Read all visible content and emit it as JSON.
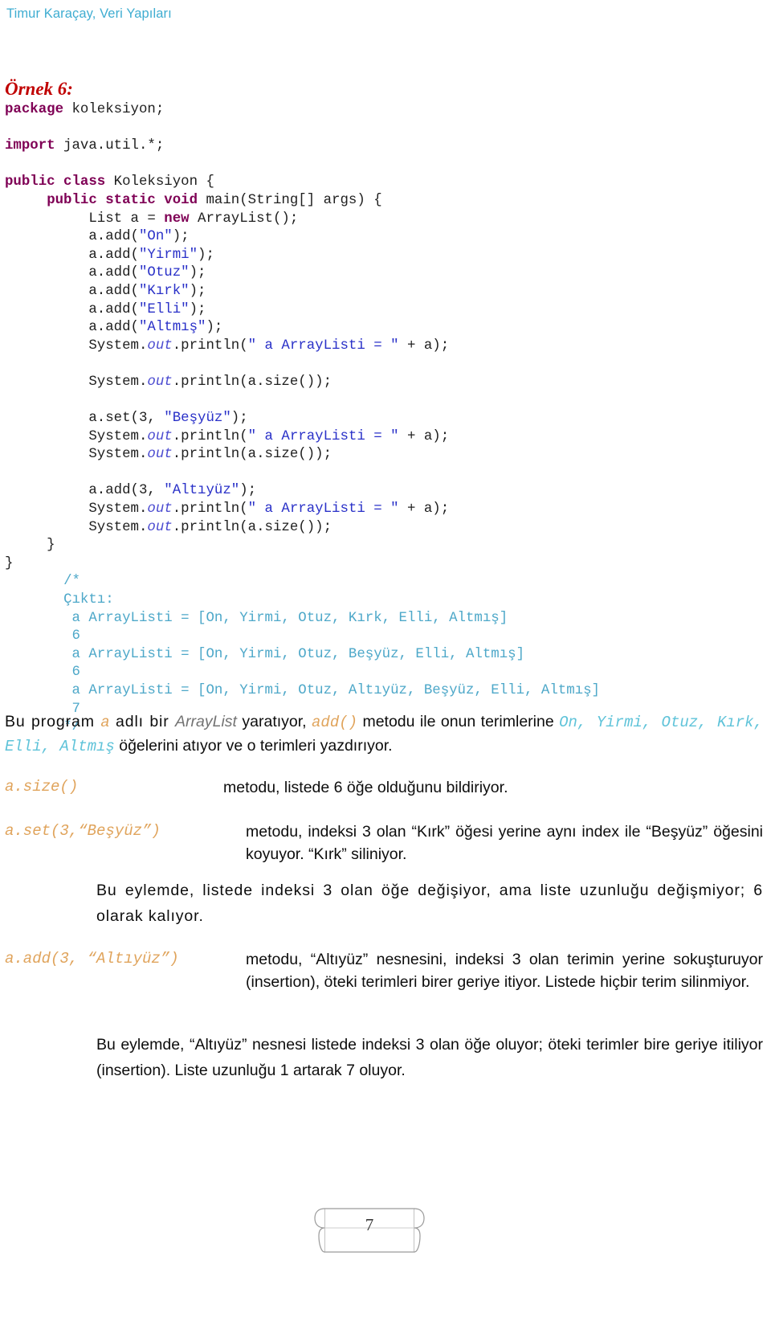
{
  "header": {
    "running_title": "Timur Karaçay, Veri Yapıları",
    "color": "#3fadd1"
  },
  "example": {
    "heading": "Örnek 6:",
    "heading_color": "#c00000"
  },
  "code": {
    "language": "java",
    "colors": {
      "keyword": "#7f0055",
      "string": "#2a31c8",
      "field": "#4b4bd0",
      "comment": "#4ea8c9",
      "plain": "#1f1f1f"
    },
    "lines": [
      {
        "id": "l1",
        "parts": [
          {
            "t": "package",
            "c": "kw"
          },
          {
            "t": " koleksiyon;",
            "c": "plain"
          }
        ]
      },
      {
        "id": "l2",
        "parts": []
      },
      {
        "id": "l3",
        "parts": [
          {
            "t": "import",
            "c": "kw"
          },
          {
            "t": " java.util.*;",
            "c": "plain"
          }
        ]
      },
      {
        "id": "l4",
        "parts": []
      },
      {
        "id": "l5",
        "parts": [
          {
            "t": "public class",
            "c": "kw"
          },
          {
            "t": " Koleksiyon {",
            "c": "plain"
          }
        ]
      },
      {
        "id": "l6",
        "parts": [
          {
            "t": "     ",
            "c": "plain"
          },
          {
            "t": "public static void",
            "c": "kw"
          },
          {
            "t": " main(String[] args) {",
            "c": "plain"
          }
        ]
      },
      {
        "id": "l7",
        "parts": [
          {
            "t": "          List a = ",
            "c": "plain"
          },
          {
            "t": "new",
            "c": "kw"
          },
          {
            "t": " ArrayList();",
            "c": "plain"
          }
        ]
      },
      {
        "id": "l8",
        "parts": [
          {
            "t": "          a.add(",
            "c": "plain"
          },
          {
            "t": "\"On\"",
            "c": "str"
          },
          {
            "t": ");",
            "c": "plain"
          }
        ]
      },
      {
        "id": "l9",
        "parts": [
          {
            "t": "          a.add(",
            "c": "plain"
          },
          {
            "t": "\"Yirmi\"",
            "c": "str"
          },
          {
            "t": ");",
            "c": "plain"
          }
        ]
      },
      {
        "id": "l10",
        "parts": [
          {
            "t": "          a.add(",
            "c": "plain"
          },
          {
            "t": "\"Otuz\"",
            "c": "str"
          },
          {
            "t": ");",
            "c": "plain"
          }
        ]
      },
      {
        "id": "l11",
        "parts": [
          {
            "t": "          a.add(",
            "c": "plain"
          },
          {
            "t": "\"Kırk\"",
            "c": "str"
          },
          {
            "t": ");",
            "c": "plain"
          }
        ]
      },
      {
        "id": "l12",
        "parts": [
          {
            "t": "          a.add(",
            "c": "plain"
          },
          {
            "t": "\"Elli\"",
            "c": "str"
          },
          {
            "t": ");",
            "c": "plain"
          }
        ]
      },
      {
        "id": "l13",
        "parts": [
          {
            "t": "          a.add(",
            "c": "plain"
          },
          {
            "t": "\"Altmış\"",
            "c": "str"
          },
          {
            "t": ");",
            "c": "plain"
          }
        ]
      },
      {
        "id": "l14",
        "parts": [
          {
            "t": "          System.",
            "c": "plain"
          },
          {
            "t": "out",
            "c": "field"
          },
          {
            "t": ".println(",
            "c": "plain"
          },
          {
            "t": "\" a ArrayListi = \"",
            "c": "str"
          },
          {
            "t": " + a);",
            "c": "plain"
          }
        ]
      },
      {
        "id": "l15",
        "parts": []
      },
      {
        "id": "l16",
        "parts": [
          {
            "t": "          System.",
            "c": "plain"
          },
          {
            "t": "out",
            "c": "field"
          },
          {
            "t": ".println(a.size());",
            "c": "plain"
          }
        ]
      },
      {
        "id": "l17",
        "parts": []
      },
      {
        "id": "l18",
        "parts": [
          {
            "t": "          a.set(3, ",
            "c": "plain"
          },
          {
            "t": "\"Beşyüz\"",
            "c": "str"
          },
          {
            "t": ");",
            "c": "plain"
          }
        ]
      },
      {
        "id": "l19",
        "parts": [
          {
            "t": "          System.",
            "c": "plain"
          },
          {
            "t": "out",
            "c": "field"
          },
          {
            "t": ".println(",
            "c": "plain"
          },
          {
            "t": "\" a ArrayListi = \"",
            "c": "str"
          },
          {
            "t": " + a);",
            "c": "plain"
          }
        ]
      },
      {
        "id": "l20",
        "parts": [
          {
            "t": "          System.",
            "c": "plain"
          },
          {
            "t": "out",
            "c": "field"
          },
          {
            "t": ".println(a.size());",
            "c": "plain"
          }
        ]
      },
      {
        "id": "l21",
        "parts": []
      },
      {
        "id": "l22",
        "parts": [
          {
            "t": "          a.add(3, ",
            "c": "plain"
          },
          {
            "t": "\"Altıyüz\"",
            "c": "str"
          },
          {
            "t": ");",
            "c": "plain"
          }
        ]
      },
      {
        "id": "l23",
        "parts": [
          {
            "t": "          System.",
            "c": "plain"
          },
          {
            "t": "out",
            "c": "field"
          },
          {
            "t": ".println(",
            "c": "plain"
          },
          {
            "t": "\" a ArrayListi = \"",
            "c": "str"
          },
          {
            "t": " + a);",
            "c": "plain"
          }
        ]
      },
      {
        "id": "l24",
        "parts": [
          {
            "t": "          System.",
            "c": "plain"
          },
          {
            "t": "out",
            "c": "field"
          },
          {
            "t": ".println(a.size());",
            "c": "plain"
          }
        ]
      },
      {
        "id": "l25",
        "parts": [
          {
            "t": "     }",
            "c": "plain"
          }
        ]
      },
      {
        "id": "l26",
        "parts": [
          {
            "t": "}",
            "c": "plain"
          }
        ]
      },
      {
        "id": "l27",
        "parts": [
          {
            "t": "       ",
            "c": "plain"
          },
          {
            "t": "/*",
            "c": "comment"
          }
        ]
      },
      {
        "id": "l28",
        "parts": [
          {
            "t": "       ",
            "c": "plain"
          },
          {
            "t": "Çıktı:",
            "c": "comment"
          }
        ]
      },
      {
        "id": "l29",
        "parts": [
          {
            "t": "        ",
            "c": "plain"
          },
          {
            "t": "a ArrayListi = [On, Yirmi, Otuz, Kırk, Elli, Altmış]",
            "c": "comment"
          }
        ]
      },
      {
        "id": "l30",
        "parts": [
          {
            "t": "        ",
            "c": "plain"
          },
          {
            "t": "6",
            "c": "comment"
          }
        ]
      },
      {
        "id": "l31",
        "parts": [
          {
            "t": "        ",
            "c": "plain"
          },
          {
            "t": "a ArrayListi = [On, Yirmi, Otuz, Beşyüz, Elli, Altmış]",
            "c": "comment"
          }
        ]
      },
      {
        "id": "l32",
        "parts": [
          {
            "t": "        ",
            "c": "plain"
          },
          {
            "t": "6",
            "c": "comment"
          }
        ]
      },
      {
        "id": "l33",
        "parts": [
          {
            "t": "        ",
            "c": "plain"
          },
          {
            "t": "a ArrayListi = [On, Yirmi, Otuz, Altıyüz, Beşyüz, Elli, Altmış]",
            "c": "comment"
          }
        ]
      },
      {
        "id": "l34",
        "parts": [
          {
            "t": "        ",
            "c": "plain"
          },
          {
            "t": "7",
            "c": "comment"
          }
        ]
      },
      {
        "id": "l35",
        "parts": [
          {
            "t": "       ",
            "c": "plain"
          },
          {
            "t": "*/",
            "c": "comment"
          }
        ]
      }
    ]
  },
  "prose": {
    "intro": {
      "s1": "Bu program ",
      "code_a": "a",
      "s2": " adlı bir ",
      "ital_arraylist": "ArrayList",
      "s3": " yaratıyor, ",
      "code_add": "add()",
      "s4": " metodu ile onun terimlerine ",
      "teal_items": "On, Yirmi, Otuz, Kırk, Elli, Altmış",
      "s5": " öğelerini atıyor ve o terimleri yazdırıyor."
    },
    "size": {
      "code": "a.size()",
      "text": "metodu, listede 6 öğe olduğunu bildiriyor."
    },
    "set": {
      "code": "a.set(3,“Beşyüz”)",
      "text": "metodu, indeksi 3 olan “Kırk” öğesi yerine aynı index ile “Beşyüz” öğesini koyuyor. “Kırk” siliniyor."
    },
    "set_note": "Bu eylemde, listede indeksi 3 olan öğe değişiyor, ama liste uzunluğu değişmiyor; 6 olarak kalıyor.",
    "add": {
      "code": "a.add(3, “Altıyüz”)",
      "text": "metodu, “Altıyüz” nesnesini, indeksi 3 olan terimin yerine sokuşturuyor (insertion), öteki terimleri birer geriye itiyor. Listede hiçbir terim silinmiyor."
    },
    "add_note": "Bu eylemde, “Altıyüz” nesnesi listede indeksi 3 olan öğe oluyor; öteki terimler bire geriye itiliyor (insertion). Liste uzunluğu 1 artarak 7 oluyor."
  },
  "footer": {
    "page_number": "7"
  }
}
